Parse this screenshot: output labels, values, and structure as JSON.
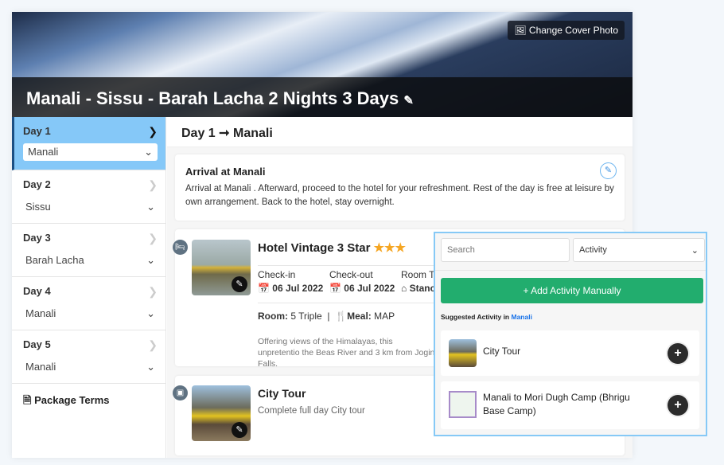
{
  "header": {
    "title": "Manali - Sissu - Barah Lacha 2 Nights 3 Days",
    "change_cover": "Change Cover Photo"
  },
  "sidebar": {
    "days": [
      {
        "label": "Day 1",
        "place": "Manali"
      },
      {
        "label": "Day 2",
        "place": "Sissu"
      },
      {
        "label": "Day 3",
        "place": "Barah Lacha"
      },
      {
        "label": "Day 4",
        "place": "Manali"
      },
      {
        "label": "Day 5",
        "place": "Manali"
      }
    ],
    "terms": "Package Terms"
  },
  "main": {
    "day_title": "Day 1",
    "day_place": "Manali",
    "arrival": {
      "title": "Arrival at Manali",
      "text": "Arrival at Manali . Afterward, proceed to the hotel for your refreshment. Rest of the day is free at leisure by own arrangement. Back to the hotel, stay overnight."
    },
    "hotel": {
      "name": "Hotel Vintage 3 Star",
      "stars": 3,
      "checkin_label": "Check-in",
      "checkin": "06 Jul 2022",
      "checkout_label": "Check-out",
      "checkout": "06 Jul 2022",
      "roomtype_label": "Room Ty",
      "roomtype": "Stanc",
      "room_label": "Room:",
      "room": "5 Triple",
      "meal_label": "Meal:",
      "meal": "MAP",
      "desc": "Offering views of the Himalayas, this unpretentio the Beas River and 3 km from Jogini Falls."
    },
    "activity": {
      "name": "City Tour",
      "desc": "Complete full day City tour"
    }
  },
  "popup": {
    "search_placeholder": "Search",
    "type": "Activity",
    "add_button": "+ Add Activity Manually",
    "suggested_label": "Suggested Activity in",
    "suggested_place": "Manali",
    "items": [
      {
        "name": "City Tour"
      },
      {
        "name": "Manali to Mori Dugh Camp (Bhrigu Base Camp)"
      }
    ]
  },
  "colors": {
    "active_day": "#85c8f8",
    "green": "#22ad6e",
    "star": "#f5a623",
    "link": "#1a73e8"
  }
}
